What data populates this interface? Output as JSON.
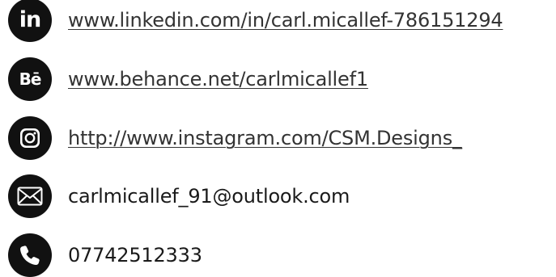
{
  "contacts": {
    "linkedin": {
      "icon": "linkedin-icon",
      "icon_text": "in",
      "text": "www.linkedin.com/in/carl.micallef-786151294"
    },
    "behance": {
      "icon": "behance-icon",
      "icon_text": "Bē",
      "text": "www.behance.net/carlmicallef1"
    },
    "instagram": {
      "icon": "instagram-icon",
      "text": "http://www.instagram.com/CSM.Designs_"
    },
    "email": {
      "icon": "envelope-icon",
      "text": "carlmicallef_91@outlook.com"
    },
    "phone": {
      "icon": "phone-icon",
      "text": "07742512333"
    }
  },
  "colors": {
    "icon_background": "#111111",
    "text": "#1a1a1a"
  }
}
